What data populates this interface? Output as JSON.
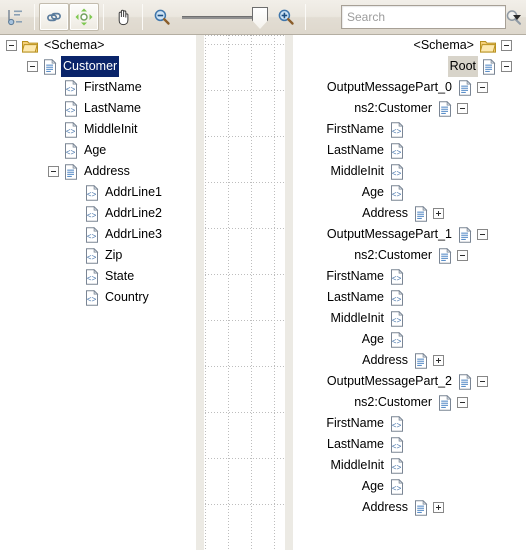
{
  "toolbar": {
    "buttons": [
      {
        "name": "auto-layout-icon",
        "title": "Auto Layout"
      },
      {
        "name": "link-icon",
        "title": "Show Links"
      },
      {
        "name": "center-node-icon",
        "title": "Center Node"
      },
      {
        "name": "pan-hand-icon",
        "title": "Pan"
      },
      {
        "name": "zoom-out-icon",
        "title": "Zoom Out"
      },
      {
        "name": "zoom-in-icon",
        "title": "Zoom In"
      }
    ],
    "zoom_slider_value": 100,
    "search": {
      "placeholder": "Search",
      "value": ""
    },
    "overflow_label": ""
  },
  "left_tree": {
    "nodes": [
      {
        "label": "<Schema>",
        "indent": 0,
        "icon": "folder-icon",
        "expander": "minus",
        "selected": false
      },
      {
        "label": "Customer",
        "indent": 1,
        "icon": "complex-element-icon",
        "expander": "minus",
        "selected": true
      },
      {
        "label": "FirstName",
        "indent": 2,
        "icon": "simple-element-icon",
        "expander": "none",
        "selected": false
      },
      {
        "label": "LastName",
        "indent": 2,
        "icon": "simple-element-icon",
        "expander": "none",
        "selected": false
      },
      {
        "label": "MiddleInit",
        "indent": 2,
        "icon": "simple-element-icon",
        "expander": "none",
        "selected": false
      },
      {
        "label": "Age",
        "indent": 2,
        "icon": "simple-element-icon",
        "expander": "none",
        "selected": false
      },
      {
        "label": "Address",
        "indent": 2,
        "icon": "complex-element-icon",
        "expander": "minus",
        "selected": false
      },
      {
        "label": "AddrLine1",
        "indent": 3,
        "icon": "simple-element-icon",
        "expander": "none",
        "selected": false
      },
      {
        "label": "AddrLine2",
        "indent": 3,
        "icon": "simple-element-icon",
        "expander": "none",
        "selected": false
      },
      {
        "label": "AddrLine3",
        "indent": 3,
        "icon": "simple-element-icon",
        "expander": "none",
        "selected": false
      },
      {
        "label": "Zip",
        "indent": 3,
        "icon": "simple-element-icon",
        "expander": "none",
        "selected": false
      },
      {
        "label": "State",
        "indent": 3,
        "icon": "simple-element-icon",
        "expander": "none",
        "selected": false
      },
      {
        "label": "Country",
        "indent": 3,
        "icon": "simple-element-icon",
        "expander": "none",
        "selected": false
      }
    ]
  },
  "right_tree": {
    "nodes": [
      {
        "label": "<Schema>",
        "icon": "folder-icon",
        "expander": "minus",
        "highlighted": false,
        "pad": 14
      },
      {
        "label": "Root",
        "icon": "complex-element-icon",
        "expander": "minus",
        "highlighted": true,
        "pad": 14
      },
      {
        "label": "OutputMessagePart_0",
        "icon": "complex-element-icon",
        "expander": "minus",
        "highlighted": false,
        "pad": 38
      },
      {
        "label": "ns2:Customer",
        "icon": "complex-element-icon",
        "expander": "minus",
        "highlighted": false,
        "pad": 58
      },
      {
        "label": "FirstName",
        "icon": "simple-element-icon",
        "expander": "none",
        "highlighted": false,
        "pad": 106
      },
      {
        "label": "LastName",
        "icon": "simple-element-icon",
        "expander": "none",
        "highlighted": false,
        "pad": 106
      },
      {
        "label": "MiddleInit",
        "icon": "simple-element-icon",
        "expander": "none",
        "highlighted": false,
        "pad": 106
      },
      {
        "label": "Age",
        "icon": "simple-element-icon",
        "expander": "none",
        "highlighted": false,
        "pad": 106
      },
      {
        "label": "Address",
        "icon": "complex-element-icon",
        "expander": "plus",
        "highlighted": false,
        "pad": 82
      },
      {
        "label": "OutputMessagePart_1",
        "icon": "complex-element-icon",
        "expander": "minus",
        "highlighted": false,
        "pad": 38
      },
      {
        "label": "ns2:Customer",
        "icon": "complex-element-icon",
        "expander": "minus",
        "highlighted": false,
        "pad": 58
      },
      {
        "label": "FirstName",
        "icon": "simple-element-icon",
        "expander": "none",
        "highlighted": false,
        "pad": 106
      },
      {
        "label": "LastName",
        "icon": "simple-element-icon",
        "expander": "none",
        "highlighted": false,
        "pad": 106
      },
      {
        "label": "MiddleInit",
        "icon": "simple-element-icon",
        "expander": "none",
        "highlighted": false,
        "pad": 106
      },
      {
        "label": "Age",
        "icon": "simple-element-icon",
        "expander": "none",
        "highlighted": false,
        "pad": 106
      },
      {
        "label": "Address",
        "icon": "complex-element-icon",
        "expander": "plus",
        "highlighted": false,
        "pad": 82
      },
      {
        "label": "OutputMessagePart_2",
        "icon": "complex-element-icon",
        "expander": "minus",
        "highlighted": false,
        "pad": 38
      },
      {
        "label": "ns2:Customer",
        "icon": "complex-element-icon",
        "expander": "minus",
        "highlighted": false,
        "pad": 58
      },
      {
        "label": "FirstName",
        "icon": "simple-element-icon",
        "expander": "none",
        "highlighted": false,
        "pad": 106
      },
      {
        "label": "LastName",
        "icon": "simple-element-icon",
        "expander": "none",
        "highlighted": false,
        "pad": 106
      },
      {
        "label": "MiddleInit",
        "icon": "simple-element-icon",
        "expander": "none",
        "highlighted": false,
        "pad": 106
      },
      {
        "label": "Age",
        "icon": "simple-element-icon",
        "expander": "none",
        "highlighted": false,
        "pad": 106
      },
      {
        "label": "Address",
        "icon": "complex-element-icon",
        "expander": "plus",
        "highlighted": false,
        "pad": 82
      }
    ]
  },
  "colors": {
    "selection": "#0a246a",
    "soft_selection": "#d6d2c8",
    "toolbar_bg": "#ece8e0",
    "grid_line": "#bdbdbd",
    "panel_bg": "#ffffff"
  }
}
